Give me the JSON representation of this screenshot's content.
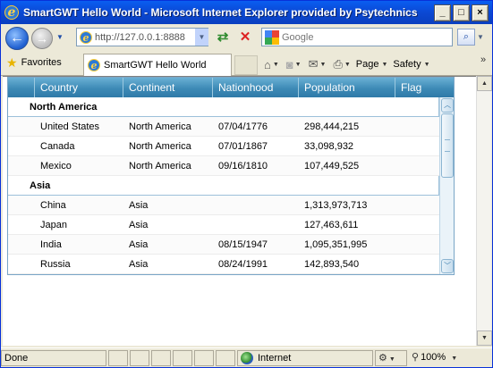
{
  "window": {
    "title": "SmartGWT Hello World - Microsoft Internet Explorer provided by Psytechnics",
    "minimize": "_",
    "maximize": "□",
    "close": "×"
  },
  "toolbar": {
    "address_value": "http://127.0.0.1:8888",
    "search_placeholder": "Google",
    "back": "←",
    "forward": "→",
    "refresh": "⇄",
    "stop": "✕",
    "search_go": "⌕"
  },
  "tabs": {
    "favorites_label": "Favorites",
    "active_tab": "SmartGWT Hello World"
  },
  "commandbar": {
    "page_label": "Page",
    "safety_label": "Safety",
    "more": "»"
  },
  "grid": {
    "columns": [
      "",
      "Country",
      "Continent",
      "Nationhood",
      "Population",
      "Flag"
    ],
    "groups": [
      {
        "name": "North America",
        "rows": [
          {
            "country": "United States",
            "continent": "North America",
            "nationhood": "07/04/1776",
            "population": "298,444,215"
          },
          {
            "country": "Canada",
            "continent": "North America",
            "nationhood": "07/01/1867",
            "population": "33,098,932"
          },
          {
            "country": "Mexico",
            "continent": "North America",
            "nationhood": "09/16/1810",
            "population": "107,449,525"
          }
        ]
      },
      {
        "name": "Asia",
        "rows": [
          {
            "country": "China",
            "continent": "Asia",
            "nationhood": "",
            "population": "1,313,973,713"
          },
          {
            "country": "Japan",
            "continent": "Asia",
            "nationhood": "",
            "population": "127,463,611"
          },
          {
            "country": "India",
            "continent": "Asia",
            "nationhood": "08/15/1947",
            "population": "1,095,351,995"
          },
          {
            "country": "Russia",
            "continent": "Asia",
            "nationhood": "08/24/1991",
            "population": "142,893,540"
          }
        ]
      }
    ]
  },
  "statusbar": {
    "status": "Done",
    "zone": "Internet",
    "zoom": "100%"
  },
  "colors": {
    "header_top": "#6ab0d4",
    "header_bottom": "#2f7aa8",
    "titlebar": "#0a5ef1"
  },
  "icons": [
    "ie-logo-icon",
    "back-icon",
    "forward-icon",
    "refresh-icon",
    "stop-icon",
    "google-icon",
    "search-go-icon",
    "favorites-star-icon",
    "home-icon",
    "rss-icon",
    "mail-icon",
    "print-icon",
    "globe-icon",
    "zoom-icon"
  ]
}
